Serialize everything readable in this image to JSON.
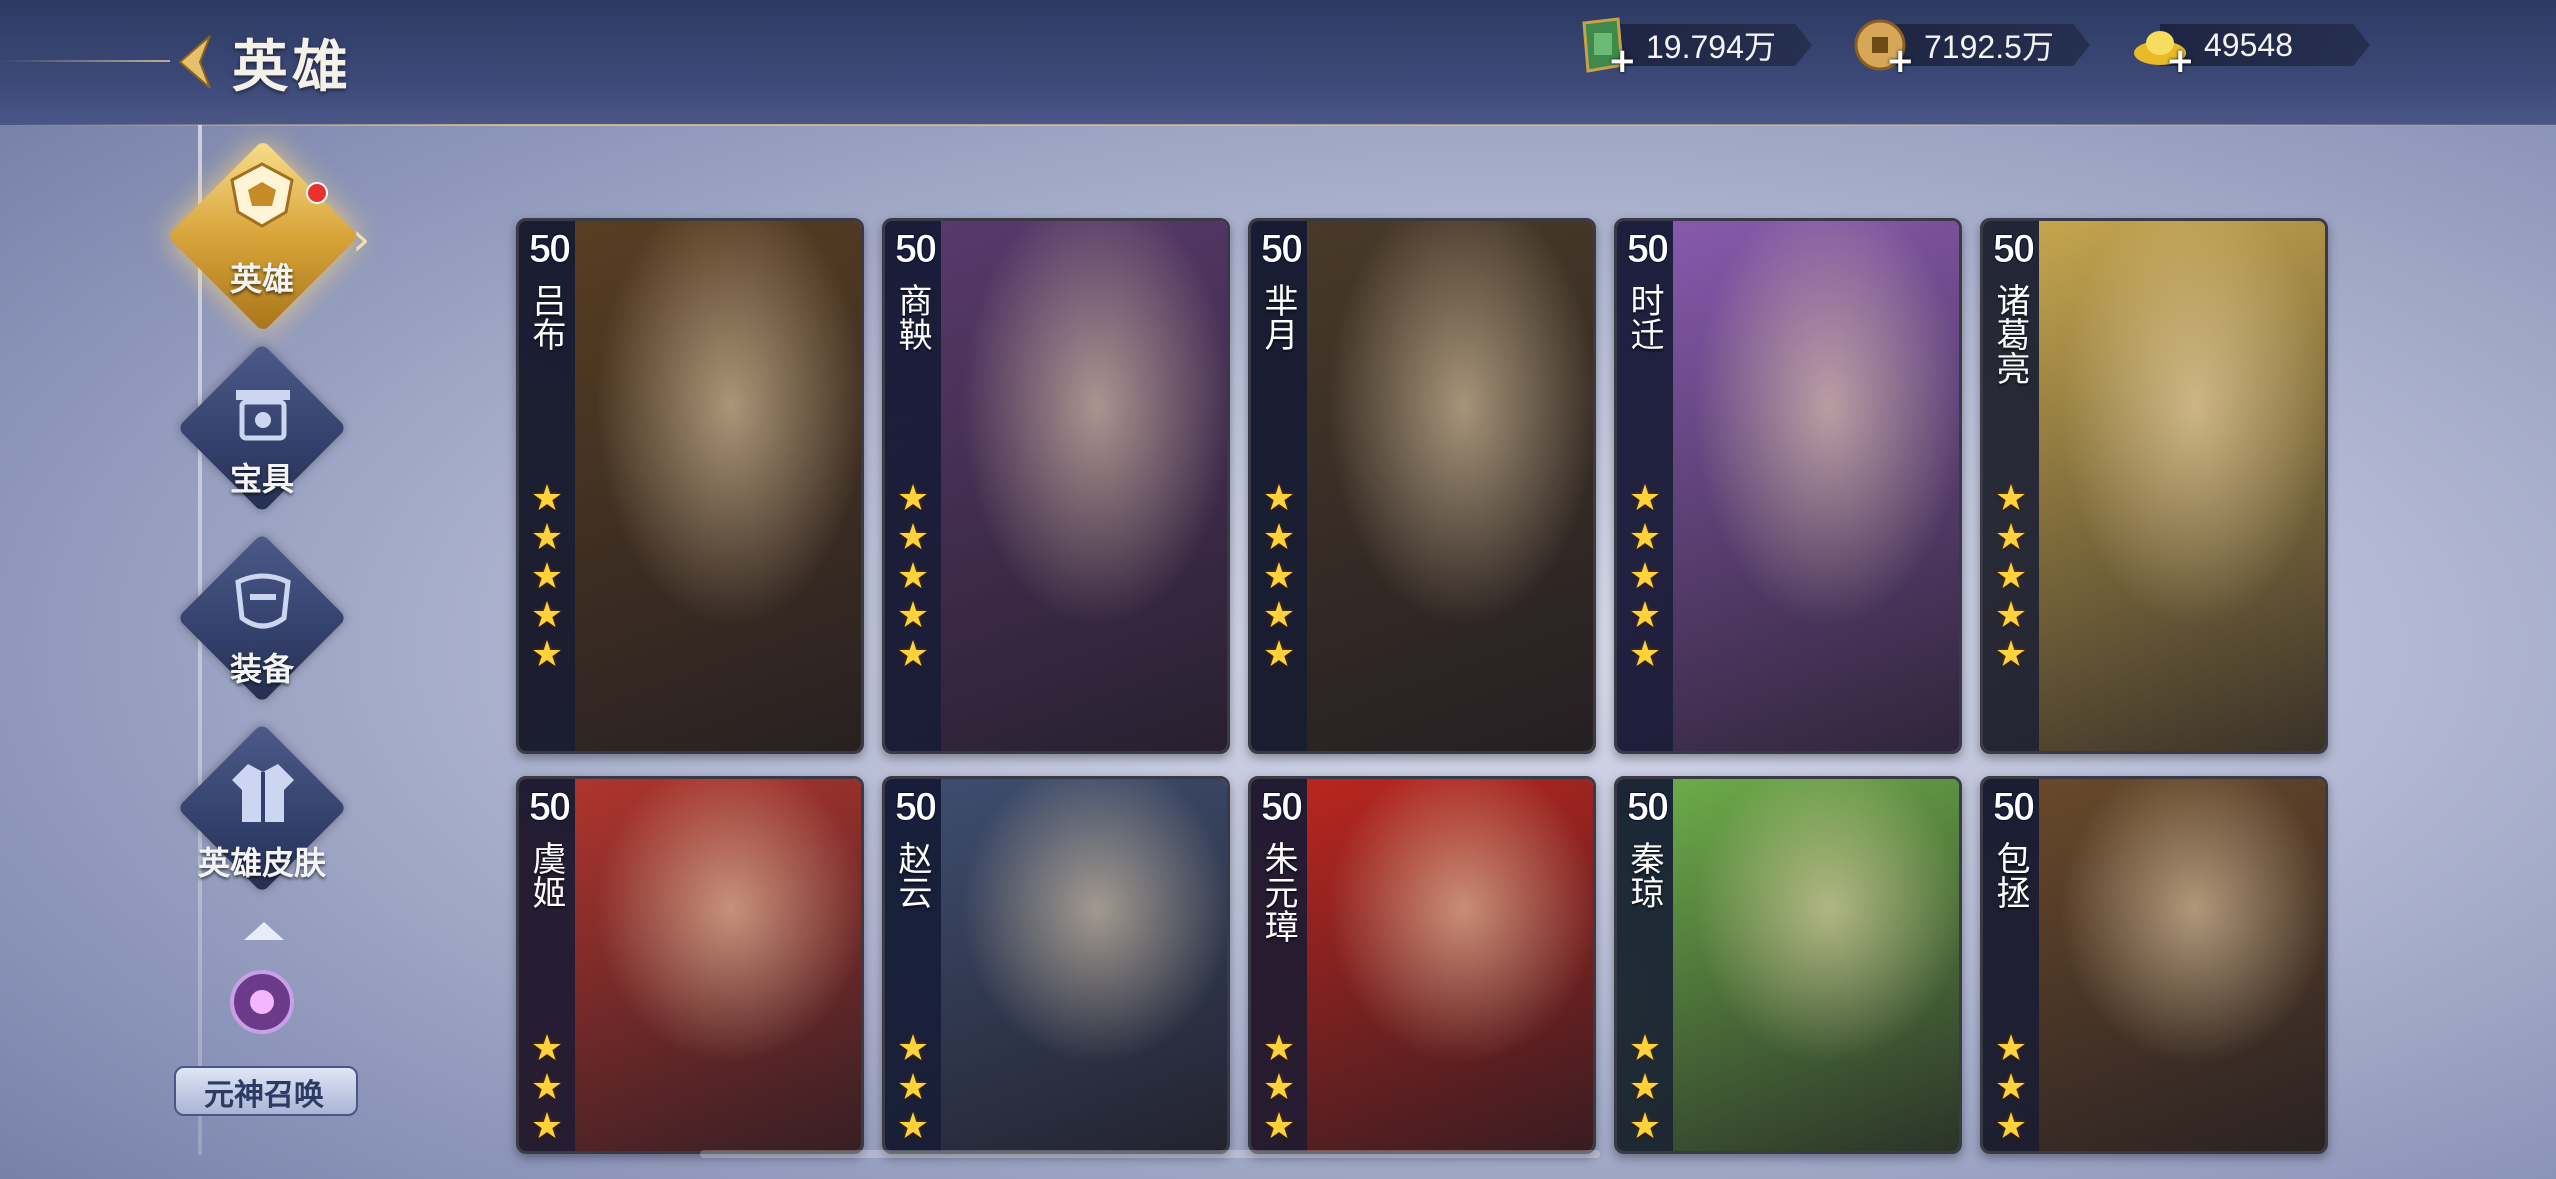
{
  "header": {
    "title": "英雄"
  },
  "currencies": [
    {
      "icon": "jade-token-icon",
      "value": "19.794万"
    },
    {
      "icon": "copper-coin-icon",
      "value": "7192.5万"
    },
    {
      "icon": "gold-ingot-icon",
      "value": "49548"
    }
  ],
  "nav": {
    "items": [
      {
        "label": "英雄",
        "icon": "hero-helmet-icon",
        "active": true,
        "badge": true
      },
      {
        "label": "宝具",
        "icon": "treasure-icon"
      },
      {
        "label": "装备",
        "icon": "equipment-icon"
      },
      {
        "label": "英雄皮肤",
        "icon": "hero-skin-icon"
      },
      {
        "label": "元神召唤",
        "icon": "spirit-summon-icon"
      }
    ]
  },
  "heroes": [
    {
      "level": "50",
      "name": "吕布",
      "stars": 5,
      "theme": "#5a3f22"
    },
    {
      "level": "50",
      "name": "商鞅",
      "stars": 5,
      "theme": "#5b3a6e"
    },
    {
      "level": "50",
      "name": "芈月",
      "stars": 5,
      "theme": "#4a3a28"
    },
    {
      "level": "50",
      "name": "时迁",
      "stars": 5,
      "theme": "#8a5bb0"
    },
    {
      "level": "50",
      "name": "诸葛亮",
      "stars": 5,
      "theme": "#c9a94f"
    },
    {
      "level": "50",
      "name": "虞姬",
      "stars": 3,
      "theme": "#b5352e"
    },
    {
      "level": "50",
      "name": "赵云",
      "stars": 3,
      "theme": "#3f4f72"
    },
    {
      "level": "50",
      "name": "朱元璋",
      "stars": 3,
      "theme": "#c0261f"
    },
    {
      "level": "50",
      "name": "秦琼",
      "stars": 3,
      "theme": "#6fb04a"
    },
    {
      "level": "50",
      "name": "包拯",
      "stars": 3,
      "theme": "#6b4a2a"
    }
  ],
  "colors": {
    "accent_gold": "#e0b24a",
    "star": "#ffd23c"
  }
}
